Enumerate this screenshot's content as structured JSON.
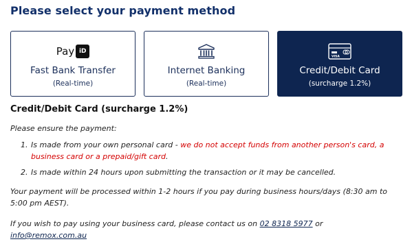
{
  "heading": "Please select your payment method",
  "payment_methods": [
    {
      "logo_text": "Pay",
      "logo_badge": "iD",
      "title": "Fast Bank Transfer",
      "subtitle": "(Real-time)",
      "icon": "payid-icon",
      "selected": false
    },
    {
      "title": "Internet Banking",
      "subtitle": "(Real-time)",
      "icon": "bank-icon",
      "selected": false
    },
    {
      "title": "Credit/Debit Card",
      "subtitle": "(surcharge 1.2%)",
      "icon": "credit-card-icon",
      "card_text": "VISA",
      "selected": true
    }
  ],
  "colors": {
    "brand_navy": "#0e2550",
    "warning_red": "#d40000"
  },
  "details": {
    "title": "Credit/Debit Card (surcharge 1.2%)",
    "intro": "Please ensure the payment:",
    "items": [
      {
        "num": "1.",
        "text_before": "Is made from your own personal card - ",
        "text_red": "we do not accept funds from another person's card, a business card or a prepaid/gift card",
        "text_after": "."
      },
      {
        "num": "2.",
        "text": "Is made within 24 hours upon submitting the transaction or it may be cancelled."
      }
    ],
    "processing_note": "Your payment will be processed within 1-2 hours if you pay during business hours/days (8:30 am to 5:00 pm AEST).",
    "contact_before": "If you wish to pay using your business card, please contact us on ",
    "phone": "02 8318 5977",
    "contact_middle": " or ",
    "email": "info@remox.com.au"
  }
}
